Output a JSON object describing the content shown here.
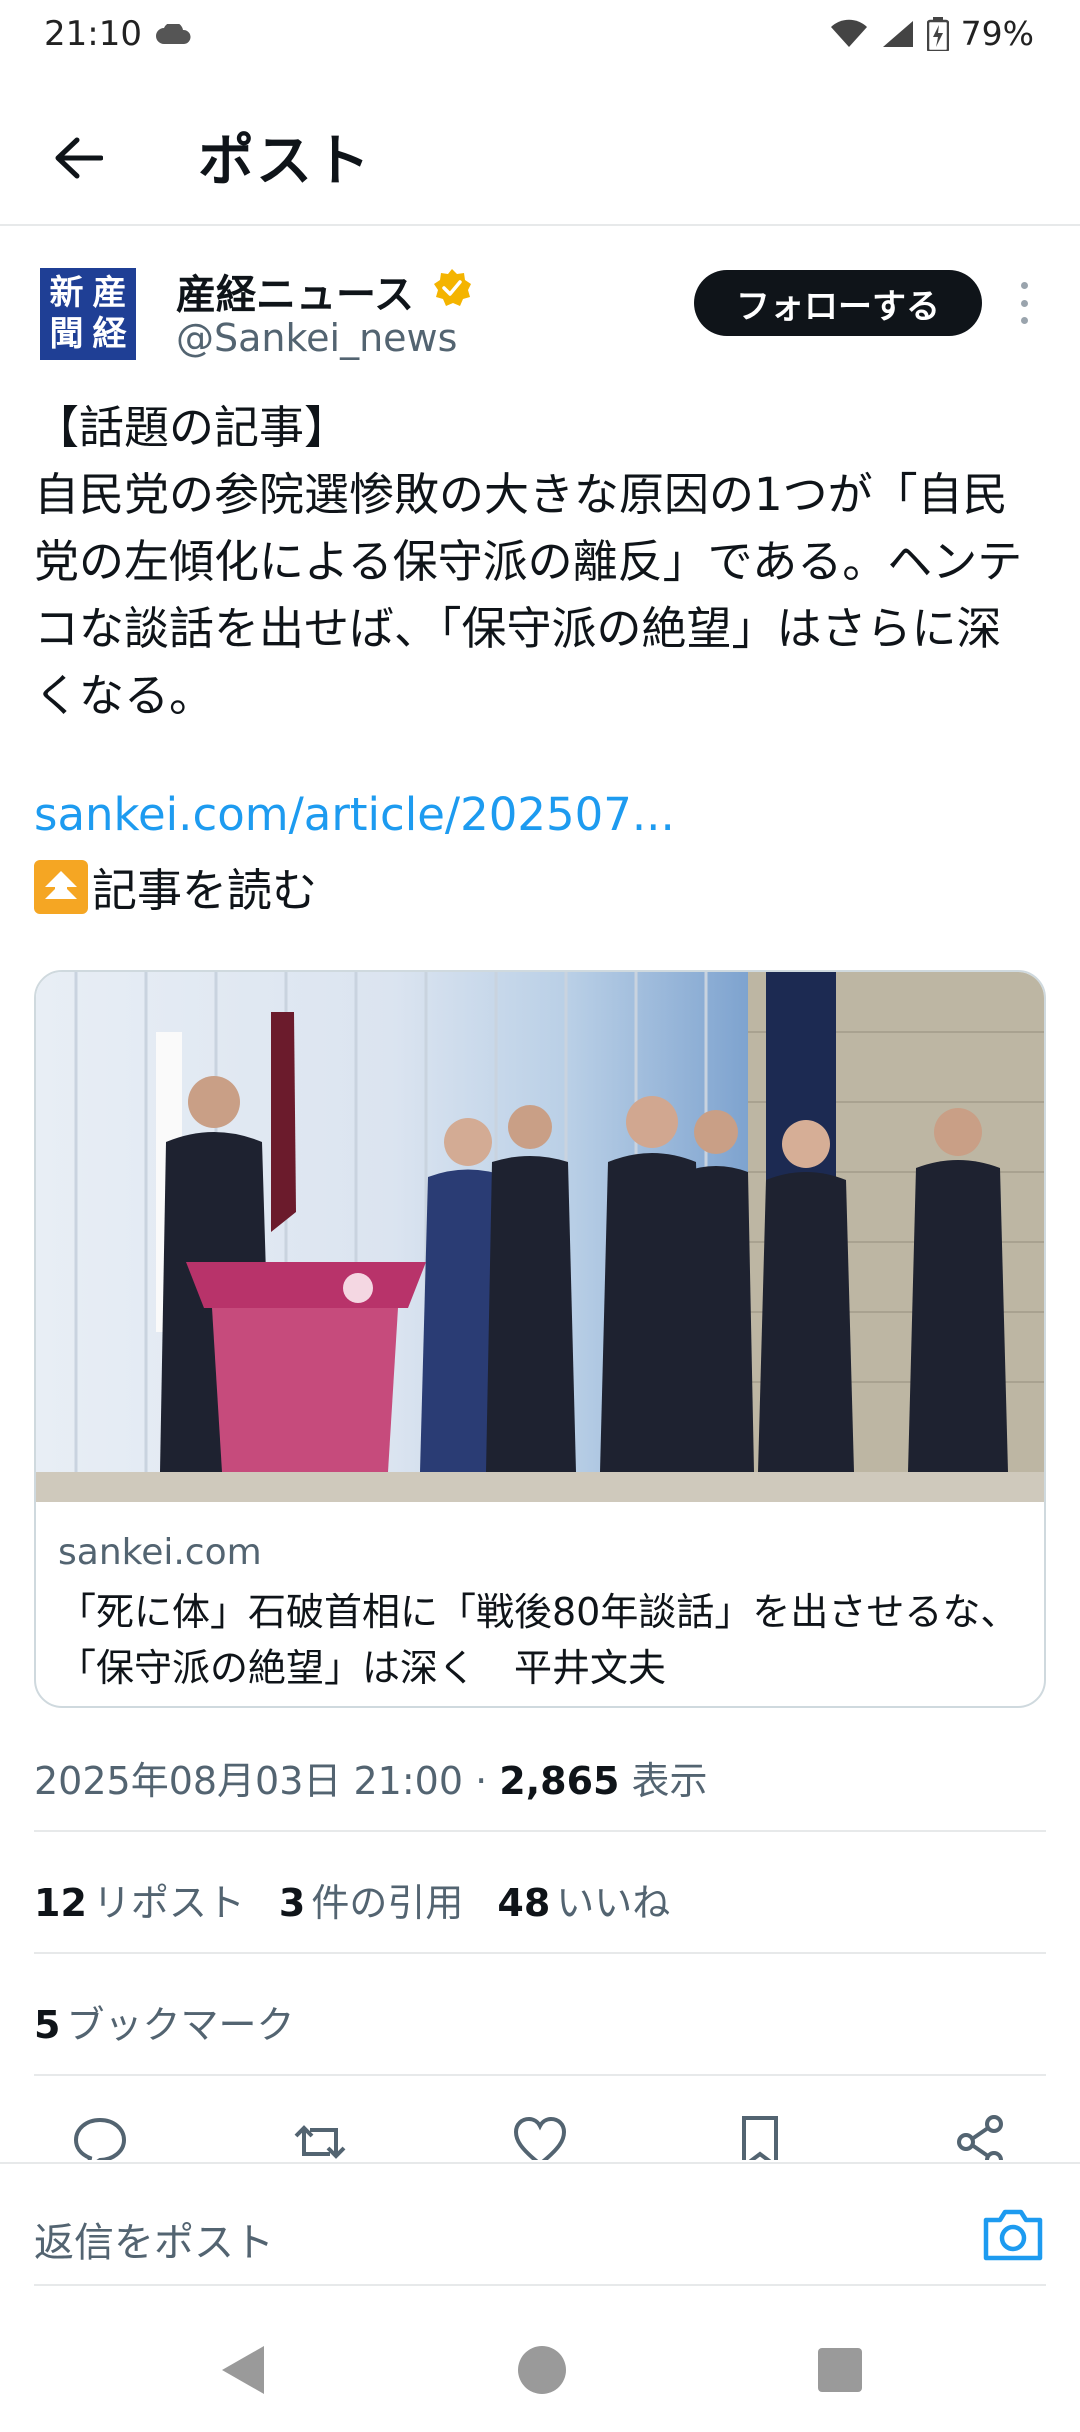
{
  "status_bar": {
    "time": "21:10",
    "battery": "79%"
  },
  "header": {
    "title": "ポスト"
  },
  "author": {
    "name": "産経ニュース",
    "handle": "@Sankei_news",
    "avatar_chars": [
      "新",
      "産",
      "聞",
      "経"
    ],
    "follow_label": "フォローする"
  },
  "tweet": {
    "text": "【話題の記事】\n自民党の参院選惨敗の大きな原因の1つが「自民党の左傾化による保守派の離反」である。ヘンテコな談話を出せば、「保守派の絶望」はさらに深くなる。",
    "link": "sankei.com/article/202507...",
    "read_more": "記事を読む"
  },
  "card": {
    "domain": "sankei.com",
    "title": "「死に体」石破首相に「戦後80年談話」を出させるな、「保守派の絶望」は深く　平井文夫"
  },
  "meta": {
    "datetime": "2025年08月03日 21:00 · ",
    "views": "2,865",
    "views_label": " 表示"
  },
  "stats": {
    "reposts": "12",
    "reposts_label": "リポスト",
    "quotes": "3",
    "quotes_label": "件の引用",
    "likes": "48",
    "likes_label": "いいね",
    "bookmarks": "5",
    "bookmarks_label": "ブックマーク"
  },
  "reply": {
    "placeholder": "返信をポスト"
  },
  "colors": {
    "accent": "#1d9bf0",
    "text": "#0f1419",
    "secondary": "#536471",
    "verified": "#f4b400"
  }
}
